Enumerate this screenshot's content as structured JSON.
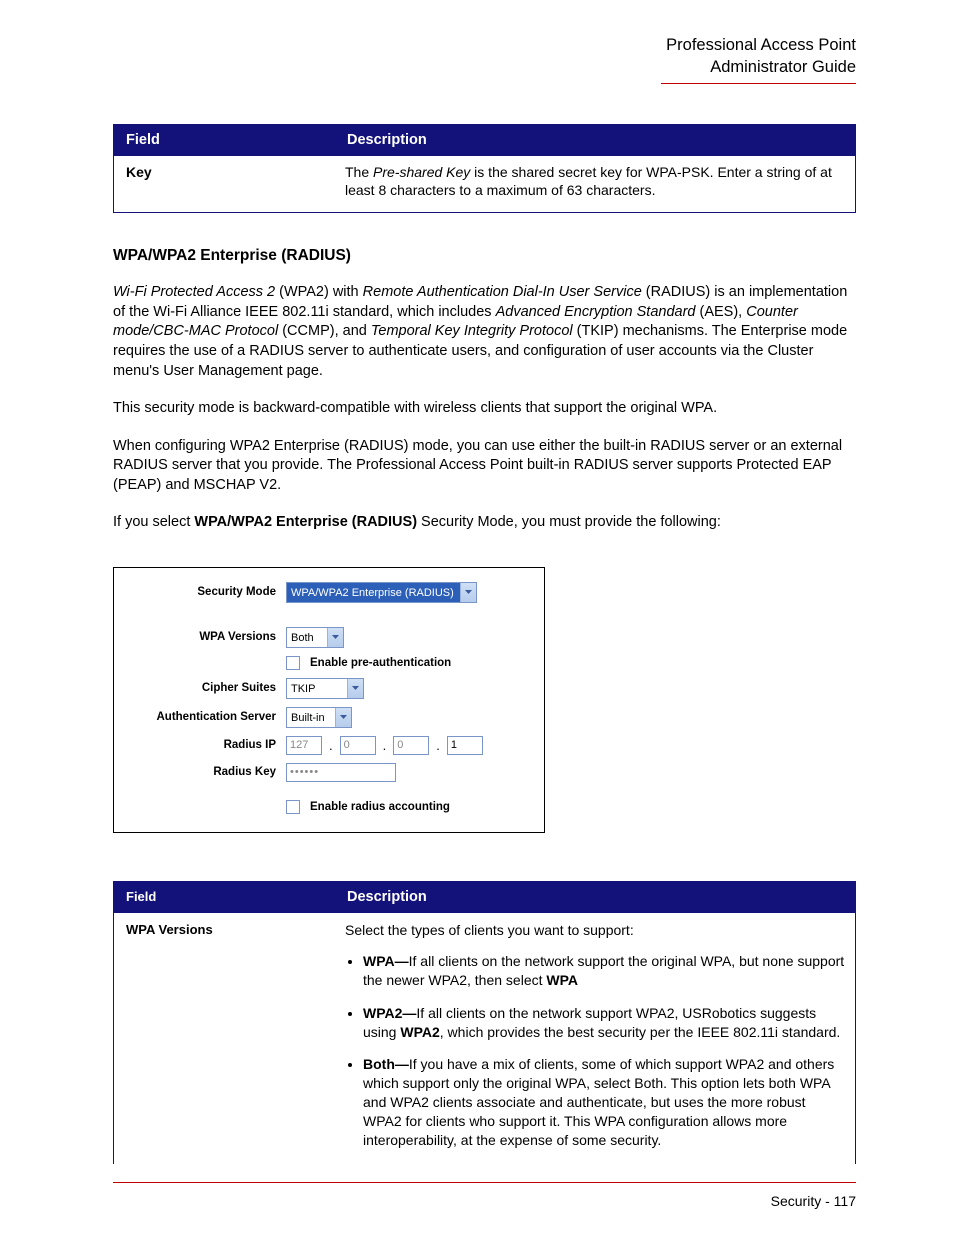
{
  "header": {
    "line1": "Professional Access Point",
    "line2": "Administrator Guide"
  },
  "table1": {
    "headers": {
      "field": "Field",
      "description": "Description"
    },
    "row": {
      "field": "Key",
      "desc_pre": "The ",
      "desc_em": "Pre-shared Key",
      "desc_post": " is the shared secret key for WPA-PSK. Enter a string of at least 8 characters to a maximum of 63 characters."
    }
  },
  "section_heading": "WPA/WPA2 Enterprise (RADIUS)",
  "para1": {
    "seg1_em": "Wi-Fi Protected Access 2",
    "seg1_plain": " (WPA2) with ",
    "seg2_em": "Remote Authentication Dial-In User Service",
    "seg2_plain": " (RADIUS) is an implementation of the Wi-Fi Alliance IEEE 802.11i standard, which includes ",
    "seg3_em": "Advanced Encryption Standard",
    "seg3_plain": " (AES), ",
    "seg4_em": "Counter mode/CBC-MAC Protocol",
    "seg4_plain": " (CCMP), and ",
    "seg5_em": "Temporal Key Integrity Protocol",
    "seg5_plain": " (TKIP) mechanisms. The Enterprise mode requires the use of a RADIUS server to authenticate users, and configuration of user accounts via the Cluster menu's User Management page."
  },
  "para2": "This security mode is backward-compatible with wireless clients that support the original WPA.",
  "para3": "When configuring WPA2 Enterprise (RADIUS) mode, you can use either the built-in RADIUS server or an external RADIUS server that you provide. The Professional Access Point built-in RADIUS server supports Protected EAP (PEAP) and MSCHAP V2.",
  "para4_pre": "If you select ",
  "para4_bold": "WPA/WPA2 Enterprise (RADIUS)",
  "para4_post": " Security Mode, you must provide the following:",
  "form": {
    "labels": {
      "security_mode": "Security Mode",
      "wpa_versions": "WPA Versions",
      "cipher_suites": "Cipher Suites",
      "auth_server": "Authentication Server",
      "radius_ip": "Radius IP",
      "radius_key": "Radius Key"
    },
    "values": {
      "security_mode": "WPA/WPA2 Enterprise (RADIUS)",
      "wpa_versions": "Both",
      "cipher_suites": "TKIP",
      "auth_server": "Built-in",
      "ip1": "127",
      "ip2": "0",
      "ip3": "0",
      "ip4": "1",
      "radius_key": "••••••"
    },
    "checks": {
      "preauth": "Enable pre-authentication",
      "accounting": "Enable radius accounting"
    }
  },
  "table2": {
    "headers": {
      "field": "Field",
      "description": "Description"
    },
    "row": {
      "field": "WPA Versions",
      "intro": "Select the types of clients you want to support:",
      "b1_label": "WPA—",
      "b1_text": "If all clients on the network support the original WPA, but none support the newer WPA2, then select ",
      "b1_tail_bold": "WPA",
      "b2_label": "WPA2—",
      "b2_text_a": "If all clients on the network support WPA2, ",
      "b2_text_b": "USRobotics",
      "b2_text_c": " suggests using ",
      "b2_text_d": "WPA2",
      "b2_text_e": ", which provides the best security per the IEEE 802.11i standard.",
      "b3_label": "Both—",
      "b3_text": "If you have a mix of clients, some of which support WPA2 and others which support only the original WPA, select Both. This option lets both WPA and WPA2 clients associate and authenticate, but uses the more robust WPA2 for clients who support it. This WPA configuration allows more interoperability, at the expense of some security."
    }
  },
  "footer": {
    "section": "Security",
    "page": "117"
  }
}
